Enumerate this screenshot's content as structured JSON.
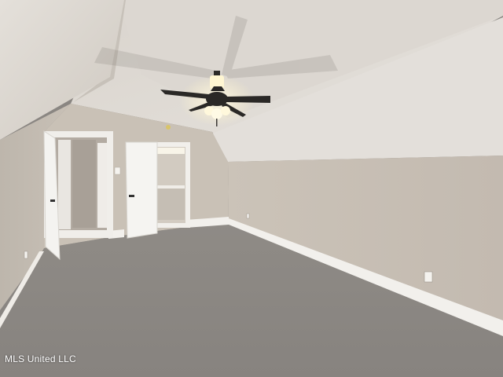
{
  "photo": {
    "watermark": "MLS United LLC"
  },
  "colors": {
    "wall": "#cbc3b8",
    "ceiling": "#d9d4ce",
    "carpet": "#8c8884",
    "trim": "#f4f2ee",
    "door": "#f3f2ef"
  },
  "icons": {
    "fan": "ceiling-fan-icon",
    "outlet": "outlet-icon",
    "switch": "light-switch-icon"
  }
}
